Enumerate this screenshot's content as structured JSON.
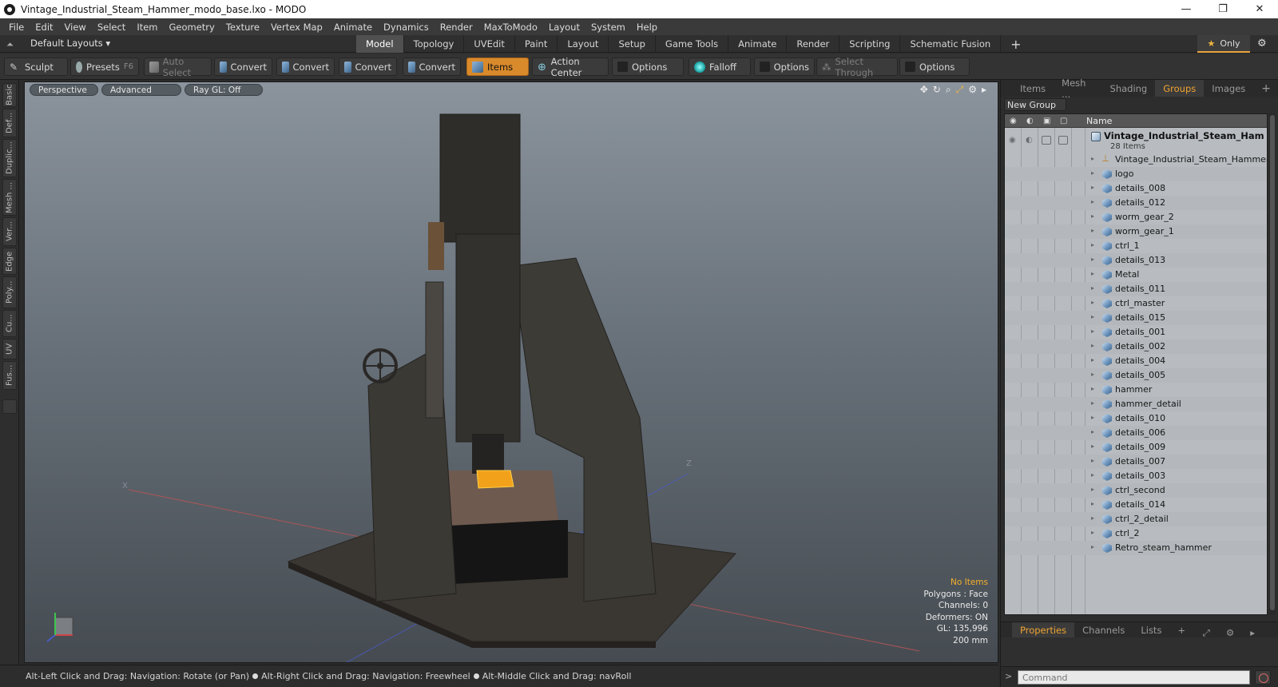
{
  "window": {
    "title": "Vintage_Industrial_Steam_Hammer_modo_base.lxo - MODO",
    "controls": [
      "—",
      "❐",
      "✕"
    ]
  },
  "menu": [
    "File",
    "Edit",
    "View",
    "Select",
    "Item",
    "Geometry",
    "Texture",
    "Vertex Map",
    "Animate",
    "Dynamics",
    "Render",
    "MaxToModo",
    "Layout",
    "System",
    "Help"
  ],
  "layout_bar": {
    "layouts_label": "Default Layouts ▾",
    "tabs": [
      "Model",
      "Topology",
      "UVEdit",
      "Paint",
      "Layout",
      "Setup",
      "Game Tools",
      "Animate",
      "Render",
      "Scripting",
      "Schematic Fusion"
    ],
    "active_tab": "Model",
    "plus": "+",
    "only_label": "Only"
  },
  "toolbar": {
    "sculpt": "Sculpt",
    "presets": "Presets",
    "presets_key": "F6",
    "auto_select": "Auto Select",
    "convert1": "Convert",
    "convert2": "Convert",
    "convert3": "Convert",
    "convert4": "Convert",
    "items": "Items",
    "action_center": "Action Center",
    "options1": "Options",
    "falloff": "Falloff",
    "options2": "Options",
    "select_through": "Select Through",
    "options3": "Options"
  },
  "left_strip": [
    "Basic",
    "Def...",
    "Duplic...",
    "Mesh ...",
    "Ver...",
    "Edge",
    "Poly...",
    "Cu...",
    "UV",
    "Fus..."
  ],
  "viewport": {
    "perspective": "Perspective",
    "advanced": "Advanced",
    "raygl": "Ray GL: Off",
    "hud": {
      "no_items": "No Items",
      "polygons": "Polygons : Face",
      "channels": "Channels: 0",
      "deformers": "Deformers: ON",
      "gl": "GL: 135,996",
      "scale": "200 mm"
    },
    "axis_x": "X",
    "axis_z": "Z"
  },
  "status": {
    "part1": "Alt-Left Click and Drag: Navigation: Rotate (or Pan)",
    "part2": "Alt-Right Click and Drag: Navigation: Freewheel",
    "part3": "Alt-Middle Click and Drag: navRoll"
  },
  "right_panel": {
    "tabs": [
      "Items",
      "Mesh ...",
      "Shading",
      "Groups",
      "Images"
    ],
    "active_tab": "Groups",
    "plus": "+",
    "new_group": "New Group",
    "header_name": "Name",
    "group_title": "Vintage_Industrial_Steam_Ham ...",
    "group_count": "28 Items",
    "items": [
      {
        "label": "Vintage_Industrial_Steam_Hammer",
        "icon": "locator"
      },
      {
        "label": "logo",
        "icon": "mesh"
      },
      {
        "label": "details_008",
        "icon": "mesh"
      },
      {
        "label": "details_012",
        "icon": "mesh"
      },
      {
        "label": "worm_gear_2",
        "icon": "mesh"
      },
      {
        "label": "worm_gear_1",
        "icon": "mesh"
      },
      {
        "label": "ctrl_1",
        "icon": "mesh"
      },
      {
        "label": "details_013",
        "icon": "mesh"
      },
      {
        "label": "Metal",
        "icon": "mesh"
      },
      {
        "label": "details_011",
        "icon": "mesh"
      },
      {
        "label": "ctrl_master",
        "icon": "mesh"
      },
      {
        "label": "details_015",
        "icon": "mesh"
      },
      {
        "label": "details_001",
        "icon": "mesh"
      },
      {
        "label": "details_002",
        "icon": "mesh"
      },
      {
        "label": "details_004",
        "icon": "mesh"
      },
      {
        "label": "details_005",
        "icon": "mesh"
      },
      {
        "label": "hammer",
        "icon": "mesh"
      },
      {
        "label": "hammer_detail",
        "icon": "mesh"
      },
      {
        "label": "details_010",
        "icon": "mesh"
      },
      {
        "label": "details_006",
        "icon": "mesh"
      },
      {
        "label": "details_009",
        "icon": "mesh"
      },
      {
        "label": "details_007",
        "icon": "mesh"
      },
      {
        "label": "details_003",
        "icon": "mesh"
      },
      {
        "label": "ctrl_second",
        "icon": "mesh"
      },
      {
        "label": "details_014",
        "icon": "mesh"
      },
      {
        "label": "ctrl_2_detail",
        "icon": "mesh"
      },
      {
        "label": "ctrl_2",
        "icon": "mesh"
      },
      {
        "label": "Retro_steam_hammer",
        "icon": "mesh"
      }
    ],
    "bottom_tabs": [
      "Properties",
      "Channels",
      "Lists"
    ],
    "bottom_active": "Properties",
    "command_placeholder": "Command"
  },
  "colors": {
    "accent": "#f0a431",
    "active_tool": "#d98a2b",
    "list_bg": "#b8bcc0"
  }
}
